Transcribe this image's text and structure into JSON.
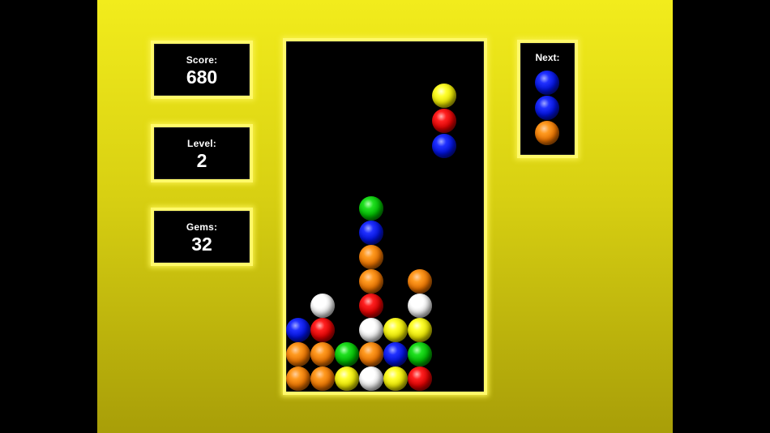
{
  "stats": {
    "score_label": "Score:",
    "score_value": "680",
    "level_label": "Level:",
    "level_value": "2",
    "gems_label": "Gems:",
    "gems_value": "32"
  },
  "next": {
    "label": "Next:",
    "gems": [
      "blue",
      "blue",
      "orange"
    ]
  },
  "board": {
    "columns": 8,
    "falling_piece": {
      "column": 6,
      "top_row": 2,
      "gems": [
        "yellow",
        "red",
        "blue"
      ]
    },
    "rows": [
      [
        null,
        null,
        null,
        null,
        null,
        null,
        null,
        null
      ],
      [
        null,
        null,
        null,
        null,
        null,
        null,
        null,
        null
      ],
      [
        null,
        null,
        null,
        null,
        null,
        null,
        null,
        null
      ],
      [
        null,
        null,
        null,
        null,
        null,
        null,
        null,
        null
      ],
      [
        null,
        null,
        null,
        null,
        null,
        null,
        null,
        null
      ],
      [
        null,
        null,
        null,
        null,
        null,
        null,
        null,
        null
      ],
      [
        null,
        null,
        null,
        "green",
        null,
        null,
        null,
        null
      ],
      [
        null,
        null,
        null,
        "blue",
        null,
        null,
        null,
        null
      ],
      [
        null,
        null,
        null,
        "orange",
        null,
        null,
        null,
        null
      ],
      [
        null,
        null,
        null,
        "orange",
        null,
        "orange",
        null,
        null
      ],
      [
        null,
        "white",
        null,
        "red",
        null,
        "white",
        null,
        null
      ],
      [
        "blue",
        "red",
        null,
        "white",
        "yellow",
        "yellow",
        null,
        null
      ],
      [
        "orange",
        "orange",
        "green",
        "orange",
        "blue",
        "green",
        null,
        null
      ],
      [
        "orange",
        "orange",
        "yellow",
        "white",
        "yellow",
        "red",
        null,
        null
      ]
    ]
  },
  "colors": {
    "background_top": "#f2ec1c",
    "background_bottom": "#a89e08",
    "panel_border": "#fff96a"
  }
}
